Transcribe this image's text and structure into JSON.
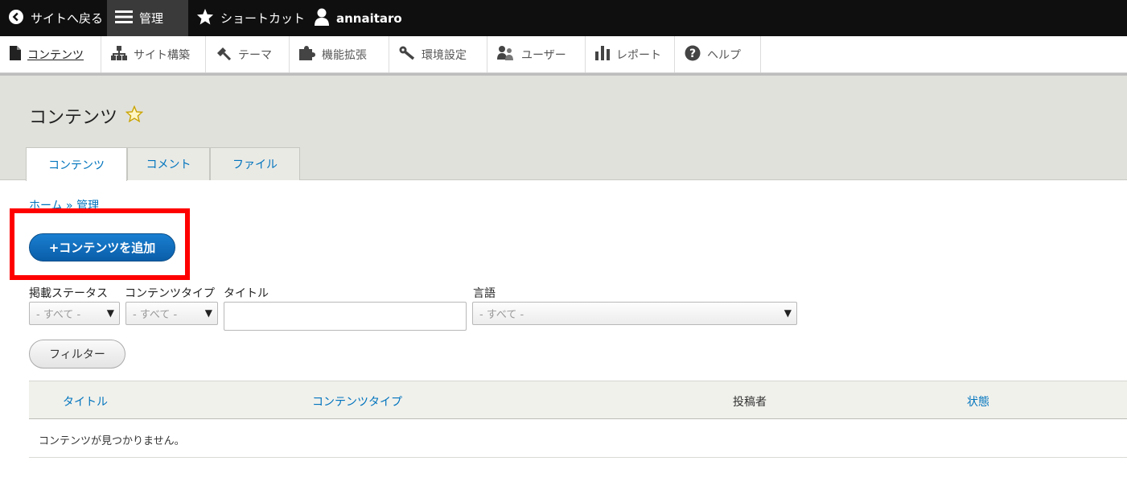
{
  "toolbar": {
    "back": "サイトへ戻る",
    "manage": "管理",
    "shortcuts": "ショートカット",
    "user": "annaitaro"
  },
  "tray": {
    "items": [
      {
        "label": "コンテンツ",
        "icon": "file-icon"
      },
      {
        "label": "サイト構築",
        "icon": "sitemap-icon"
      },
      {
        "label": "テーマ",
        "icon": "paint-icon"
      },
      {
        "label": "機能拡張",
        "icon": "puzzle-icon"
      },
      {
        "label": "環境設定",
        "icon": "wrench-icon"
      },
      {
        "label": "ユーザー",
        "icon": "people-icon"
      },
      {
        "label": "レポート",
        "icon": "bar-chart-icon"
      },
      {
        "label": "ヘルプ",
        "icon": "help-icon"
      }
    ]
  },
  "page": {
    "title": "コンテンツ",
    "tabs": [
      "コンテンツ",
      "コメント",
      "ファイル"
    ]
  },
  "breadcrumb": {
    "home": "ホーム",
    "sep": "»",
    "admin": "管理"
  },
  "actions": {
    "add_content": "+コンテンツを追加"
  },
  "filters": {
    "status_label": "掲載ステータス",
    "status_value": "- すべて -",
    "type_label": "コンテンツタイプ",
    "type_value": "- すべて -",
    "title_label": "タイトル",
    "title_value": "",
    "lang_label": "言語",
    "lang_value": "- すべて -",
    "filter_button": "フィルター"
  },
  "table": {
    "headers": [
      "タイトル",
      "コンテンツタイプ",
      "投稿者",
      "状態"
    ],
    "empty_message": "コンテンツが見つかりません。"
  },
  "colors": {
    "accent": "#0074bd",
    "toolbar_bg": "#0f0f0f",
    "highlight": "#ff0000"
  }
}
